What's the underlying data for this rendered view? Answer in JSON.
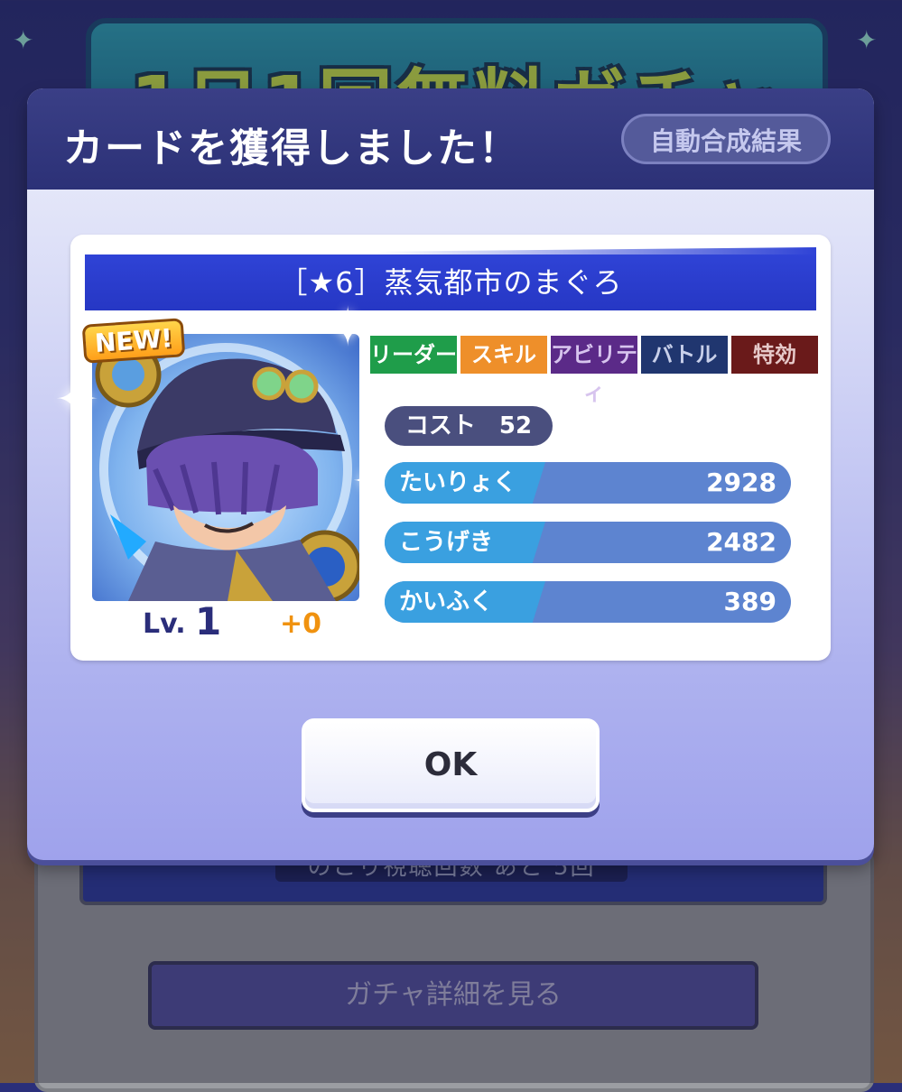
{
  "background": {
    "banner_text": "1日1回無料ガチャ",
    "watch_count_text": "のこり視聴回数 あと 5回",
    "detail_button_label": "ガチャ詳細を見る"
  },
  "dialog": {
    "title": "カードを獲得しました！",
    "auto_result_label": "自動合成結果",
    "card": {
      "name": "［★6］蒸気都市のまぐろ",
      "new_badge": "NEW!",
      "level_label": "Lv.",
      "level": "1",
      "plus": "+0",
      "tabs": [
        "リーダー",
        "スキル",
        "アビリティ",
        "バトル",
        "特効"
      ],
      "cost_text": "コスト　52",
      "stats": [
        {
          "label": "たいりょく",
          "value": "2928"
        },
        {
          "label": "こうげき",
          "value": "2482"
        },
        {
          "label": "かいふく",
          "value": "389"
        }
      ]
    },
    "ok_label": "OK"
  },
  "colors": {
    "header": "#2c3177",
    "name_bar": "#2f43d6",
    "stat_label": "#3aa0e0",
    "stat_bar": "#5d84d0",
    "tab_leader": "#1f9d4a",
    "tab_skill": "#ee8f2a"
  }
}
